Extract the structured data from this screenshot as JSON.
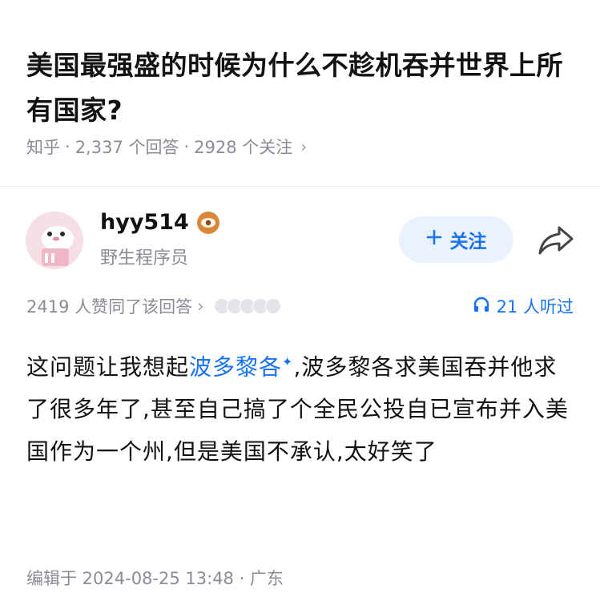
{
  "question": {
    "title": "美国最强盛的时候为什么不趁机吞并世界上所有国家?",
    "source": "知乎",
    "answers": "2,337 个回答",
    "followers": "2928 个关注",
    "sep": "·"
  },
  "author": {
    "name": "hyy514",
    "bio": "野生程序员",
    "follow_label": "关注",
    "avatar_color": "#f6dfe5"
  },
  "answer_stats": {
    "likes_text": "2419 人赞同了该回答",
    "listen_text": "21 人听过"
  },
  "content": {
    "part1": "这问题让我想起",
    "link": "波多黎各",
    "spark": "✦",
    "part2": ",波多黎各求美国吞并他求了很多年了,甚至自己搞了个全民公投自已宣布并入美国作为一个州,但是美国不承认,太好笑了"
  },
  "footer": {
    "edited": "编辑于 2024-08-25 13:48 · 广东"
  },
  "colors": {
    "accent": "#1772f6",
    "muted": "#8b8b96",
    "badge": "#d8893a"
  }
}
